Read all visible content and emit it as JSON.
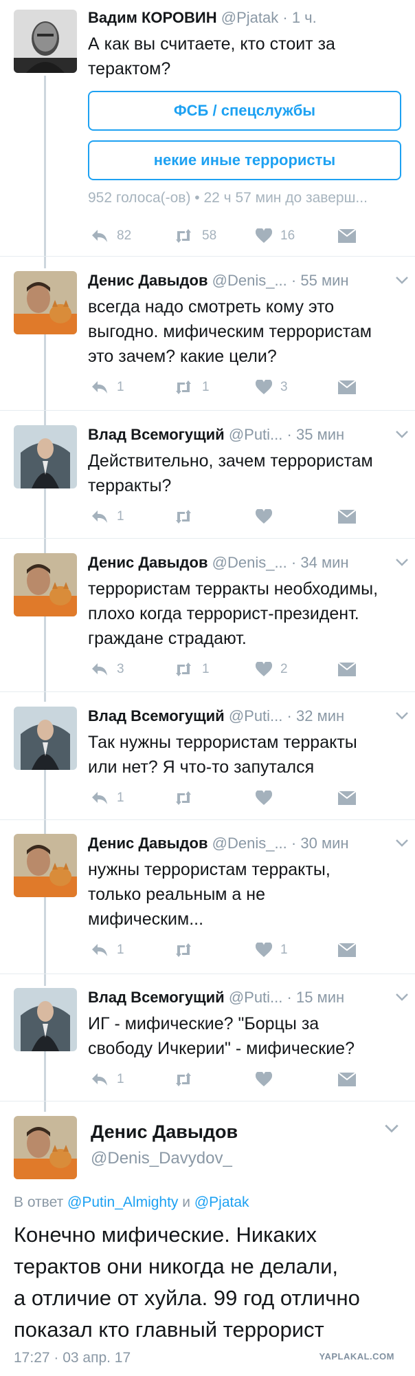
{
  "tweets": [
    {
      "name": "Вадим КОРОВИН",
      "handle": "@Pjatak",
      "time": "1 ч.",
      "text_lines": [
        "А как вы считаете, кто стоит за",
        "терактом?"
      ],
      "poll": {
        "options": [
          "ФСБ / спецслужбы",
          "некие иные террористы"
        ],
        "meta": "952 голоса(-ов) • 22 ч 57 мин до заверш..."
      },
      "replies": "82",
      "retweets": "58",
      "likes": "16"
    },
    {
      "name": "Денис Давыдов",
      "handle": "@Denis_...",
      "time": "55 мин",
      "text_lines": [
        "всегда надо смотреть кому это",
        "выгодно. мифическим террористам",
        "это зачем? какие цели?"
      ],
      "replies": "1",
      "retweets": "1",
      "likes": "3"
    },
    {
      "name": "Влад Всемогущий",
      "handle": "@Puti...",
      "time": "35 мин",
      "text_lines": [
        "Действительно, зачем террористам",
        "терракты?"
      ],
      "replies": "1",
      "retweets": "",
      "likes": ""
    },
    {
      "name": "Денис Давыдов",
      "handle": "@Denis_...",
      "time": "34 мин",
      "text_lines": [
        "террористам терракты необходимы,",
        "плохо когда террорист-президент.",
        "граждане страдают."
      ],
      "replies": "3",
      "retweets": "1",
      "likes": "2"
    },
    {
      "name": "Влад Всемогущий",
      "handle": "@Puti...",
      "time": "32 мин",
      "text_lines": [
        "Так нужны террористам терракты",
        "или нет? Я что-то запутался"
      ],
      "replies": "1",
      "retweets": "",
      "likes": ""
    },
    {
      "name": "Денис Давыдов",
      "handle": "@Denis_...",
      "time": "30 мин",
      "text_lines": [
        "нужны террористам терракты,",
        "только реальным а не",
        "мифическим..."
      ],
      "replies": "1",
      "retweets": "",
      "likes": "1"
    },
    {
      "name": "Влад Всемогущий",
      "handle": "@Puti...",
      "time": "15 мин",
      "text_lines": [
        "ИГ - мифические? \"Борцы за",
        "свободу Ичкерии\" - мифические?"
      ],
      "replies": "1",
      "retweets": "",
      "likes": ""
    }
  ],
  "main_tweet": {
    "name": "Денис Давыдов",
    "handle": "@Denis_Davydov_",
    "reply_prefix": "В ответ",
    "reply_user1": "@Putin_Almighty",
    "reply_and": "и",
    "reply_user2": "@Pjatak",
    "text_lines": [
      "Конечно мифические. Никаких",
      "терактов они никогда не делали,",
      "а отличие от хуйла. 99 год отлично",
      "показал кто главный террорист"
    ],
    "timestamp": "17:27 · 03 апр. 17"
  },
  "watermark": "YAPLAKAL.COM",
  "icons": {
    "reply": "reply-icon",
    "retweet": "retweet-icon",
    "like": "heart-icon",
    "dm": "envelope-icon",
    "caret": "chevron-down-icon"
  },
  "colors": {
    "accent": "#1da1f2",
    "muted": "#8a98a5",
    "icon": "#a4b1bc",
    "thread_line": "#cdd6dd"
  }
}
